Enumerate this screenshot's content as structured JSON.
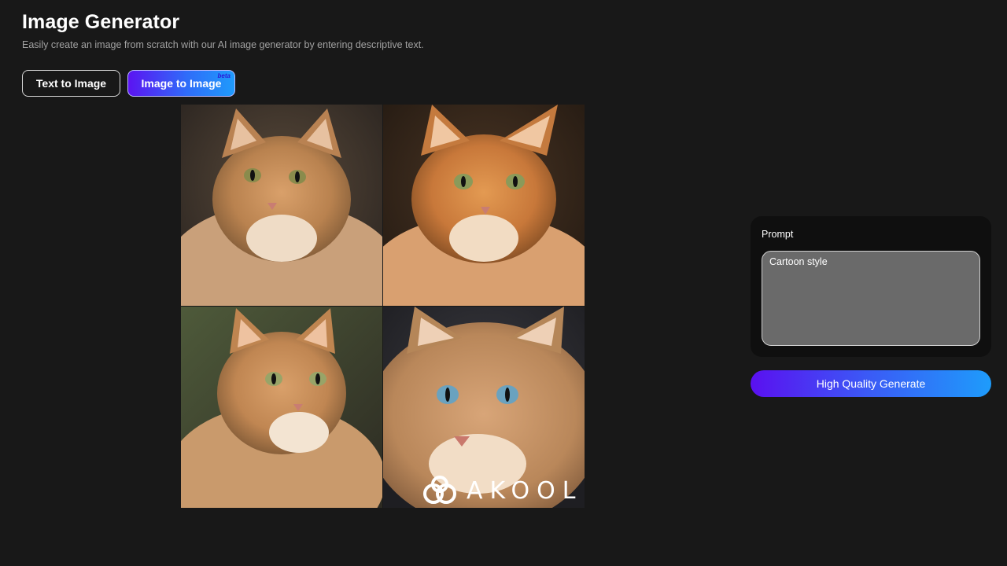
{
  "header": {
    "title": "Image Generator",
    "subtitle": "Easily create an image from scratch with our AI image generator by entering descriptive text."
  },
  "tabs": [
    {
      "label": "Text to Image",
      "active": false
    },
    {
      "label": "Image to Image",
      "active": true,
      "badge": "beta"
    }
  ],
  "gallery": {
    "images": [
      {
        "alt": "fluffy ginger cat portrait, green eyes"
      },
      {
        "alt": "ginger cat portrait, green eyes"
      },
      {
        "alt": "long-haired ginger cat, green eyes"
      },
      {
        "alt": "ginger cat close-up, blue eyes"
      }
    ],
    "watermark": "AKOOL"
  },
  "prompt": {
    "label": "Prompt",
    "value": "Cartoon style"
  },
  "generate_button": {
    "label": "High Quality Generate"
  },
  "colors": {
    "background": "#181818",
    "accent_start": "#5a10f0",
    "accent_end": "#1e9cfb",
    "panel": "#0f0f0f"
  }
}
